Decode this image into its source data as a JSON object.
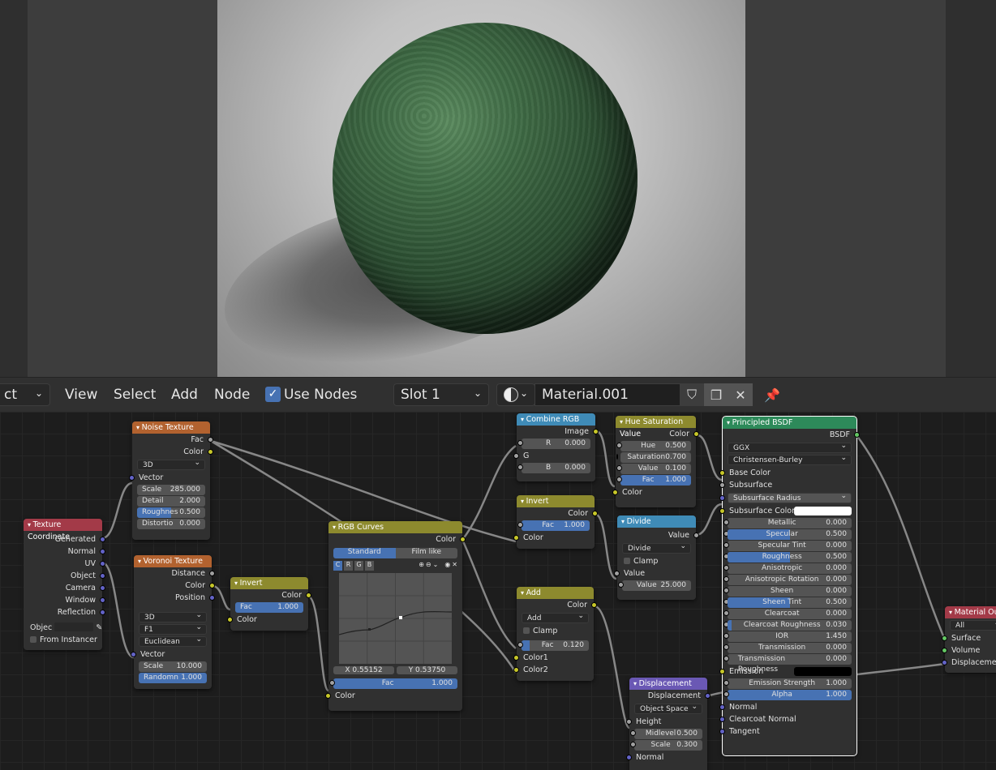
{
  "header": {
    "object_mode": "ct",
    "menus": [
      "View",
      "Select",
      "Add",
      "Node"
    ],
    "use_nodes_label": "Use Nodes",
    "use_nodes_checked": true,
    "slot": "Slot 1",
    "material_name": "Material.001"
  },
  "nodes": {
    "texture_coordinate": {
      "title": "Texture Coordinate",
      "outputs": [
        "Generated",
        "Normal",
        "UV",
        "Object",
        "Camera",
        "Window",
        "Reflection"
      ],
      "object_label": "Objec",
      "from_instancer": "From Instancer"
    },
    "noise_texture": {
      "title": "Noise Texture",
      "outputs": [
        "Fac",
        "Color"
      ],
      "dimension": "3D",
      "vector_label": "Vector",
      "fields": [
        {
          "label": "Scale",
          "value": "285.000"
        },
        {
          "label": "Detail",
          "value": "2.000"
        },
        {
          "label": "Roughnes",
          "value": "0.500"
        },
        {
          "label": "Distortio",
          "value": "0.000"
        }
      ]
    },
    "voronoi_texture": {
      "title": "Voronoi Texture",
      "outputs": [
        "Distance",
        "Color",
        "Position"
      ],
      "dimension": "3D",
      "feature": "F1",
      "distance": "Euclidean",
      "vector_label": "Vector",
      "fields": [
        {
          "label": "Scale",
          "value": "10.000"
        },
        {
          "label": "Randomn",
          "value": "1.000"
        }
      ]
    },
    "invert_1": {
      "title": "Invert",
      "output": "Color",
      "fac_label": "Fac",
      "fac_value": "1.000",
      "color_label": "Color"
    },
    "rgb_curves": {
      "title": "RGB Curves",
      "output": "Color",
      "tabs": [
        "Standard",
        "Film like"
      ],
      "channels": [
        "C",
        "R",
        "G",
        "B"
      ],
      "x_readout": "X 0.55152",
      "y_readout": "Y 0.53750",
      "fac_label": "Fac",
      "fac_value": "1.000",
      "color_label": "Color"
    },
    "combine_rgb": {
      "title": "Combine RGB",
      "output": "Image",
      "fields": [
        {
          "label": "R",
          "value": "0.000"
        },
        {
          "label": "G",
          "value": ""
        },
        {
          "label": "B",
          "value": "0.000"
        }
      ]
    },
    "invert_2": {
      "title": "Invert",
      "output": "Color",
      "fac_label": "Fac",
      "fac_value": "1.000",
      "color_label": "Color"
    },
    "add": {
      "title": "Add",
      "output": "Color",
      "blend": "Add",
      "clamp": "Clamp",
      "fac_label": "Fac",
      "fac_value": "0.120",
      "inputs": [
        "Color1",
        "Color2"
      ]
    },
    "hue_saturation": {
      "title": "Hue Saturation Value",
      "output": "Color",
      "fields": [
        {
          "label": "Hue",
          "value": "0.500"
        },
        {
          "label": "Saturation",
          "value": "0.700"
        },
        {
          "label": "Value",
          "value": "0.100"
        },
        {
          "label": "Fac",
          "value": "1.000"
        }
      ],
      "color_label": "Color"
    },
    "divide": {
      "title": "Divide",
      "output": "Value",
      "operation": "Divide",
      "clamp": "Clamp",
      "value_label": "Value",
      "value_field_label": "Value",
      "value_field": "25.000"
    },
    "displacement": {
      "title": "Displacement",
      "output": "Displacement",
      "space": "Object Space",
      "height_label": "Height",
      "fields": [
        {
          "label": "Midlevel",
          "value": "0.500"
        },
        {
          "label": "Scale",
          "value": "0.300"
        }
      ],
      "normal_label": "Normal"
    },
    "principled_bsdf": {
      "title": "Principled BSDF",
      "output": "BSDF",
      "distribution": "GGX",
      "subsurface_method": "Christensen-Burley",
      "base_color_label": "Base Color",
      "subsurface_label": "Subsurface",
      "subsurface_radius": "Subsurface Radius",
      "subsurface_color_label": "Subsurface Color",
      "fields": [
        {
          "label": "Metallic",
          "value": "0.000",
          "fill": 0
        },
        {
          "label": "Specular",
          "value": "0.500",
          "fill": 0.5
        },
        {
          "label": "Specular Tint",
          "value": "0.000",
          "fill": 0
        },
        {
          "label": "Roughness",
          "value": "0.500",
          "fill": 0.5
        },
        {
          "label": "Anisotropic",
          "value": "0.000",
          "fill": 0
        },
        {
          "label": "Anisotropic Rotation",
          "value": "0.000",
          "fill": 0
        },
        {
          "label": "Sheen",
          "value": "0.000",
          "fill": 0
        },
        {
          "label": "Sheen Tint",
          "value": "0.500",
          "fill": 0.5
        },
        {
          "label": "Clearcoat",
          "value": "0.000",
          "fill": 0
        },
        {
          "label": "Clearcoat Roughness",
          "value": "0.030",
          "fill": 0.03
        },
        {
          "label": "IOR",
          "value": "1.450",
          "fill": 0
        },
        {
          "label": "Transmission",
          "value": "0.000",
          "fill": 0
        },
        {
          "label": "Transmission Roughness",
          "value": "0.000",
          "fill": 0
        }
      ],
      "emission_label": "Emission",
      "emission_strength_label": "Emission Strength",
      "emission_strength": "1.000",
      "alpha_label": "Alpha",
      "alpha": "1.000",
      "vector_inputs": [
        "Normal",
        "Clearcoat Normal",
        "Tangent"
      ]
    },
    "material_output": {
      "title": "Material Out",
      "target": "All",
      "inputs": [
        "Surface",
        "Volume",
        "Displacement"
      ]
    }
  },
  "colors": {
    "accent": "#4772b3",
    "header_input": "#a33a48",
    "header_texture": "#b2622f",
    "header_color": "#8d8a2e",
    "header_converter": "#3f8bb7",
    "header_shader": "#2d8a5a",
    "header_vector": "#6a58b4",
    "header_output": "#a33a48"
  }
}
